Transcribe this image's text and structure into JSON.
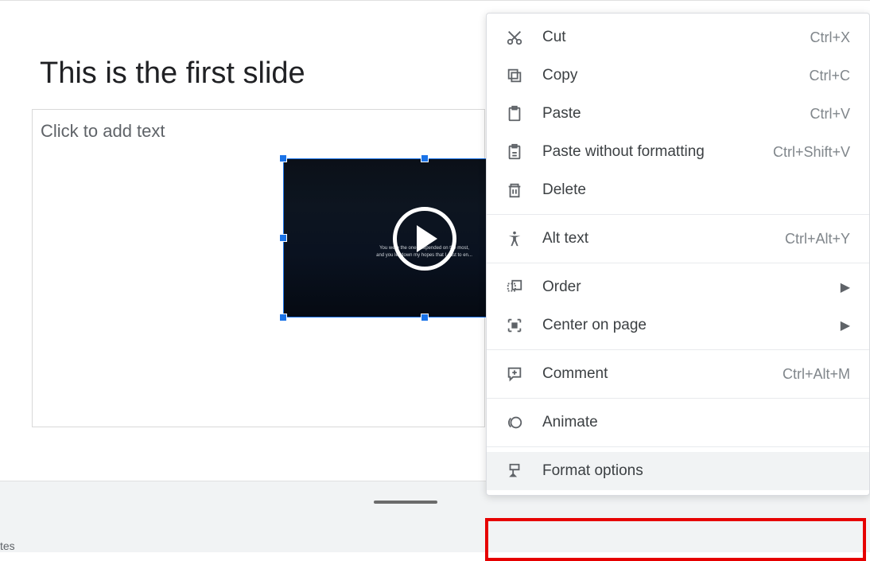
{
  "slide": {
    "title": "This is the first slide",
    "text_placeholder": "Click to add text",
    "video_subtitle1": "You were the one I depended on the most,",
    "video_subtitle2": "and you let down my hopes that I cast to en..."
  },
  "notes_label": "tes",
  "menu": {
    "cut": {
      "label": "Cut",
      "shortcut": "Ctrl+X"
    },
    "copy": {
      "label": "Copy",
      "shortcut": "Ctrl+C"
    },
    "paste": {
      "label": "Paste",
      "shortcut": "Ctrl+V"
    },
    "paste_no_format": {
      "label": "Paste without formatting",
      "shortcut": "Ctrl+Shift+V"
    },
    "delete": {
      "label": "Delete"
    },
    "alt_text": {
      "label": "Alt text",
      "shortcut": "Ctrl+Alt+Y"
    },
    "order": {
      "label": "Order"
    },
    "center": {
      "label": "Center on page"
    },
    "comment": {
      "label": "Comment",
      "shortcut": "Ctrl+Alt+M"
    },
    "animate": {
      "label": "Animate"
    },
    "format_options": {
      "label": "Format options"
    }
  }
}
